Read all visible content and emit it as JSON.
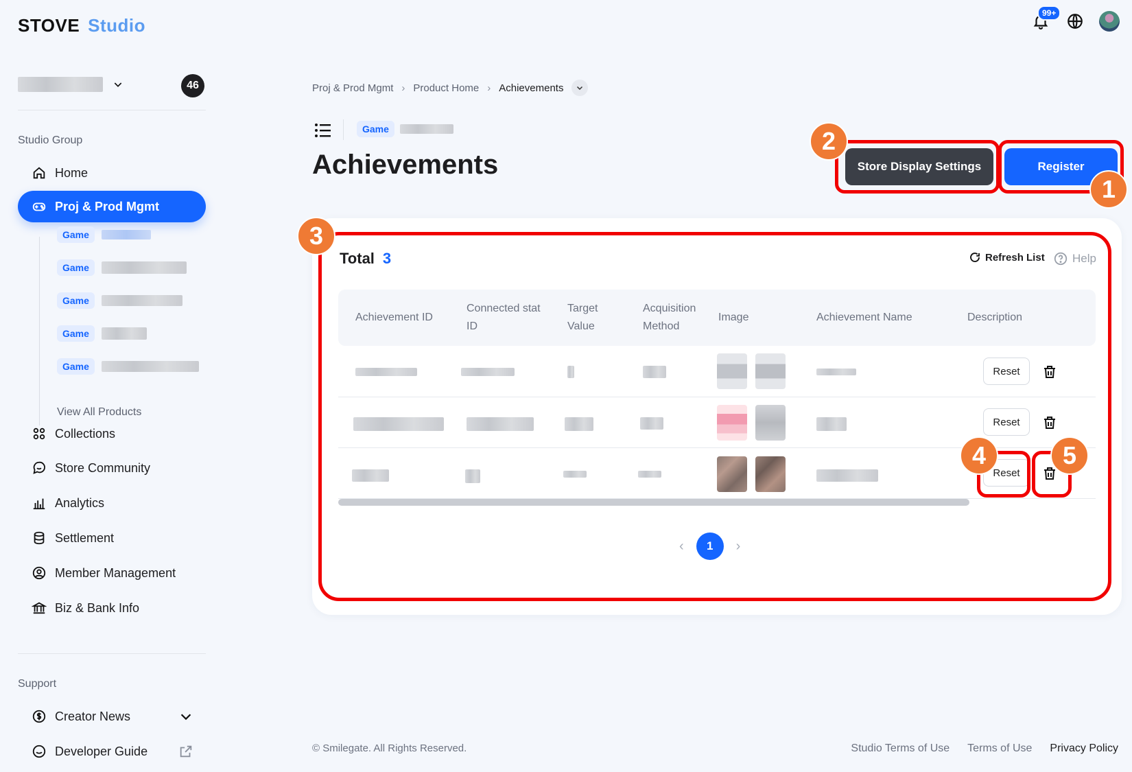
{
  "header": {
    "logo_primary": "STOVE",
    "logo_secondary": "Studio",
    "notification_badge": "99+",
    "icons": [
      "bell-icon",
      "globe-icon",
      "avatar"
    ]
  },
  "sidebar": {
    "org_count": "46",
    "group_label": "Studio Group",
    "items": [
      {
        "label": "Home",
        "icon": "home-icon"
      },
      {
        "label": "Proj & Prod Mgmt",
        "icon": "gamepad-icon"
      },
      {
        "label": "Collections",
        "icon": "grid-icon"
      },
      {
        "label": "Store Community",
        "icon": "chat-icon"
      },
      {
        "label": "Analytics",
        "icon": "bar-chart-icon"
      },
      {
        "label": "Settlement",
        "icon": "database-icon"
      },
      {
        "label": "Member Management",
        "icon": "user-circle-icon"
      },
      {
        "label": "Biz & Bank Info",
        "icon": "bank-icon"
      }
    ],
    "sub_products": [
      "Game",
      "Game",
      "Game",
      "Game",
      "Game"
    ],
    "view_all": "View All Products",
    "support_label": "Support",
    "support_items": [
      {
        "label": "Creator News",
        "icon": "dollar-icon"
      },
      {
        "label": "Developer Guide",
        "icon": "smile-icon"
      }
    ]
  },
  "breadcrumb": [
    "Proj & Prod Mgmt",
    "Product Home",
    "Achievements"
  ],
  "page": {
    "game_tag": "Game",
    "title": "Achievements",
    "store_display_button": "Store Display Settings",
    "register_button": "Register"
  },
  "markers": [
    "1",
    "2",
    "3",
    "4",
    "5"
  ],
  "table": {
    "total_label": "Total",
    "total_count": "3",
    "refresh_label": "Refresh List",
    "help_label": "Help",
    "columns": [
      [
        "Achievement ID"
      ],
      [
        "Connected stat",
        "ID"
      ],
      [
        "Target",
        "Value"
      ],
      [
        "Acquisition",
        "Method"
      ],
      [
        "Image"
      ],
      [
        "Achievement Name"
      ],
      [
        "Description"
      ]
    ],
    "reset_label": "Reset"
  },
  "pagination": {
    "current": "1"
  },
  "footer": {
    "copyright": "© Smilegate. All Rights Reserved.",
    "links": [
      "Studio Terms of Use",
      "Terms of Use",
      "Privacy Policy"
    ]
  },
  "colors": {
    "accent": "#1565ff",
    "highlight": "#f10000",
    "marker": "#ef7a34",
    "dark_button": "#3b3f47"
  }
}
